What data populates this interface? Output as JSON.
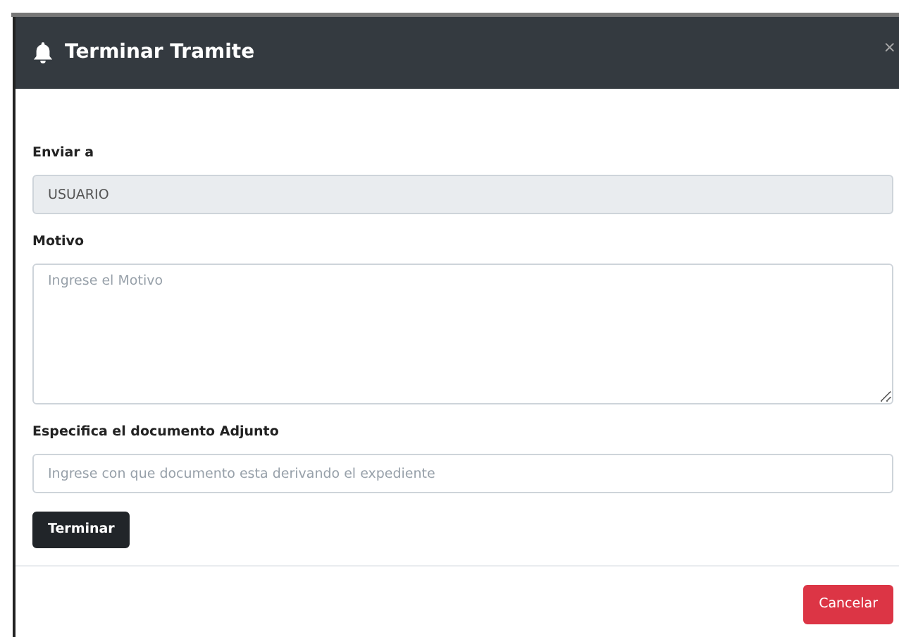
{
  "modal": {
    "title": "Terminar Tramite",
    "close": "×"
  },
  "fields": [
    {
      "kind": "input",
      "label": "Enviar a",
      "value": "USUARIO",
      "disabled": true
    },
    {
      "kind": "textarea",
      "label": "Motivo",
      "placeholder": "Ingrese el Motivo",
      "disabled": false
    },
    {
      "kind": "input",
      "label": "Especifica el documento Adjunto",
      "placeholder": "Ingrese con que documento esta derivando el expediente",
      "disabled": false
    }
  ],
  "submit": "Terminar",
  "footer_buttons": [
    {
      "label": "Cancelar",
      "kind": "danger"
    }
  ]
}
